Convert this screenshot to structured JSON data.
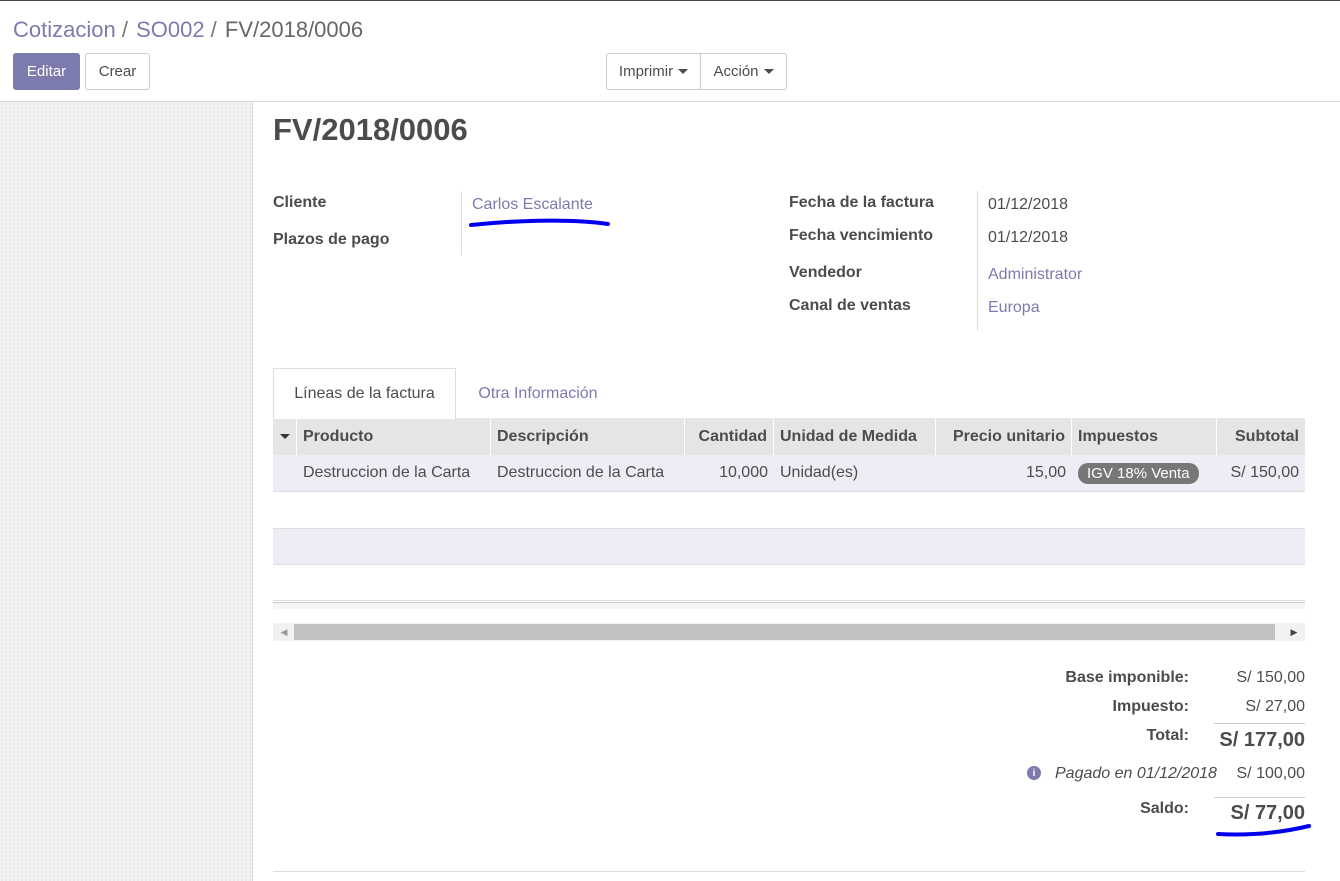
{
  "breadcrumb": [
    {
      "label": "Cotizacion",
      "link": true
    },
    {
      "label": "SO002",
      "link": true
    },
    {
      "label": "FV/2018/0006",
      "link": false
    }
  ],
  "buttons": {
    "edit": "Editar",
    "create": "Crear",
    "print": "Imprimir",
    "action": "Acción"
  },
  "invoice": {
    "title": "FV/2018/0006",
    "left_fields": {
      "customer_label": "Cliente",
      "customer_value": "Carlos Escalante",
      "payment_terms_label": "Plazos de pago",
      "payment_terms_value": ""
    },
    "right_fields": [
      {
        "label": "Fecha de la factura",
        "value": "01/12/2018",
        "link": false
      },
      {
        "label": "Fecha vencimiento",
        "value": "01/12/2018",
        "link": false
      },
      {
        "label": "Vendedor",
        "value": "Administrator",
        "link": true
      },
      {
        "label": "Canal de ventas",
        "value": "Europa",
        "link": true
      }
    ]
  },
  "tabs": [
    {
      "label": "Líneas de la factura",
      "active": true
    },
    {
      "label": "Otra Información",
      "active": false
    }
  ],
  "table": {
    "headers": [
      "Producto",
      "Descripción",
      "Cantidad",
      "Unidad de Medida",
      "Precio unitario",
      "Impuestos",
      "Subtotal"
    ],
    "rows": [
      {
        "product": "Destruccion de la Carta",
        "description": "Destruccion de la Carta",
        "quantity": "10,000",
        "uom": "Unidad(es)",
        "unit_price": "15,00",
        "tax": "IGV 18% Venta",
        "subtotal": "S/ 150,00"
      }
    ]
  },
  "totals": {
    "base_label": "Base imponible:",
    "base_value": "S/ 150,00",
    "tax_label": "Impuesto:",
    "tax_value": "S/ 27,00",
    "total_label": "Total:",
    "total_value": "S/ 177,00",
    "payment_text": "Pagado en 01/12/2018",
    "payment_value": "S/ 100,00",
    "balance_label": "Saldo:",
    "balance_value": "S/ 77,00"
  },
  "colors": {
    "primary": "#7c7bad",
    "annotation": "#0000ee"
  }
}
